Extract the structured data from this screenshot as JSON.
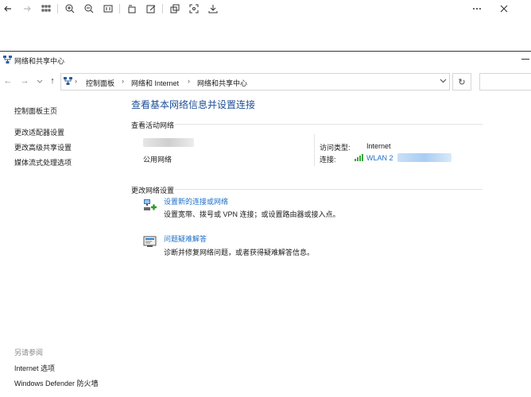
{
  "window": {
    "title": "网络和共享中心"
  },
  "address": {
    "crumbs": [
      "控制面板",
      "网络和 Internet",
      "网络和共享中心"
    ]
  },
  "sidebar": {
    "home": "控制面板主页",
    "links": [
      "更改适配器设置",
      "更改高级共享设置",
      "媒体流式处理选项"
    ],
    "see_also_title": "另请参阅",
    "see_also": [
      "Internet 选项",
      "Windows Defender 防火墙"
    ]
  },
  "main": {
    "title": "查看基本网络信息并设置连接",
    "active_networks": {
      "section_title": "查看活动网络",
      "network_type": "公用网络",
      "access_type_label": "访问类型:",
      "access_type_value": "Internet",
      "connection_label": "连接:",
      "connection_value": "WLAN 2"
    },
    "change_settings": {
      "section_title": "更改网络设置",
      "items": [
        {
          "title": "设置新的连接或网络",
          "desc": "设置宽带、拨号或 VPN 连接；或设置路由器或接入点。"
        },
        {
          "title": "问题疑难解答",
          "desc": "诊断并修复网络问题，或者获得疑难解答信息。"
        }
      ]
    }
  },
  "icons": {
    "viewer_toolbar": [
      "back-icon",
      "forward-icon",
      "grid-icon",
      "zoom-in-icon",
      "zoom-out-icon",
      "fit-icon",
      "rotate-icon",
      "edit-icon",
      "copy-icon",
      "crop-icon",
      "save-icon",
      "more-icon",
      "close-icon"
    ]
  },
  "colors": {
    "title_blue": "#1e4f98",
    "link_blue": "#1e6fc7",
    "wifi_green": "#3aa53a"
  }
}
